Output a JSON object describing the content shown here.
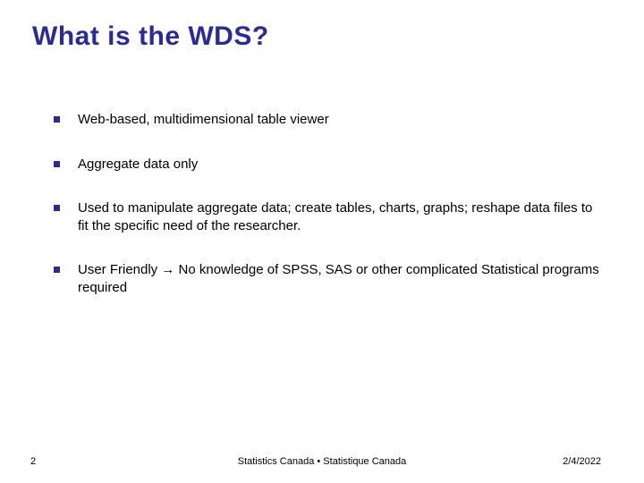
{
  "title": "What is the WDS?",
  "bullets": [
    "Web-based, multidimensional table viewer",
    "Aggregate data only",
    "Used to manipulate aggregate data; create tables, charts, graphs; reshape data files to fit the specific need of the researcher.",
    "User Friendly → No knowledge of SPSS, SAS or other complicated Statistical programs required"
  ],
  "footer": {
    "page": "2",
    "center": "Statistics Canada • Statistique Canada",
    "date": "2/4/2022"
  }
}
